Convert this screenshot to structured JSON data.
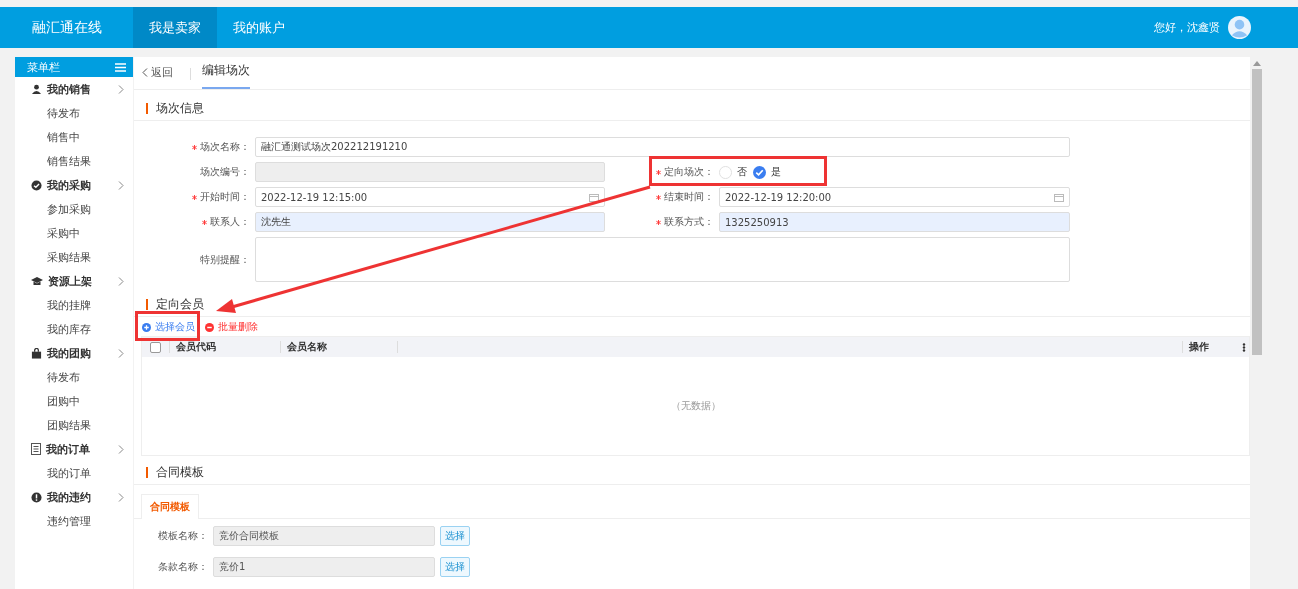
{
  "header": {
    "logo": "融汇通在线",
    "nav": [
      {
        "label": "我是卖家",
        "selected": true
      },
      {
        "label": "我的账户",
        "selected": false
      }
    ],
    "greeting": "您好，沈鑫贤"
  },
  "breadcrumb": {
    "back": "返回",
    "tab": "编辑场次"
  },
  "sidebar": {
    "title": "菜单栏",
    "groups": [
      {
        "label": "我的销售",
        "kind": "person",
        "children": [
          {
            "label": "待发布"
          },
          {
            "label": "销售中"
          },
          {
            "label": "销售结果"
          }
        ]
      },
      {
        "label": "我的采购",
        "kind": "check",
        "children": [
          {
            "label": "参加采购"
          },
          {
            "label": "采购中"
          },
          {
            "label": "采购结果"
          }
        ]
      },
      {
        "label": "资源上架",
        "kind": "cap",
        "children": [
          {
            "label": "我的挂牌"
          },
          {
            "label": "我的库存"
          }
        ]
      },
      {
        "label": "我的团购",
        "kind": "bag",
        "children": [
          {
            "label": "待发布"
          },
          {
            "label": "团购中"
          },
          {
            "label": "团购结果"
          }
        ]
      },
      {
        "label": "我的订单",
        "kind": "doc",
        "children": [
          {
            "label": "我的订单"
          }
        ]
      },
      {
        "label": "我的违约",
        "kind": "alert",
        "children": [
          {
            "label": "违约管理"
          }
        ]
      }
    ]
  },
  "info": {
    "title": "场次信息",
    "fields": [
      {
        "kind": "wide",
        "label": "场次名称：",
        "required": true,
        "value": "融汇通测试场次202212191210",
        "disabled": false,
        "autofilled": false
      },
      {
        "kind": "text",
        "label": "场次编号：",
        "required": false,
        "disabled": true,
        "autofilled": false
      },
      {
        "kind": "radio",
        "label": "定向场次：",
        "required": true,
        "options": [
          {
            "label": "否",
            "selected": false
          },
          {
            "label": "是",
            "selected": true
          }
        ]
      },
      {
        "kind": "date",
        "label": "开始时间：",
        "required": true,
        "value": "2022-12-19 12:15:00"
      },
      {
        "kind": "date",
        "label": "结束时间：",
        "required": true,
        "value": "2022-12-19 12:20:00"
      },
      {
        "kind": "text",
        "label": "联系人：",
        "required": true,
        "value": "沈先生",
        "disabled": false,
        "autofilled": true
      },
      {
        "kind": "text",
        "label": "联系方式：",
        "required": true,
        "value": "1325250913",
        "disabled": false,
        "autofilled": true
      },
      {
        "kind": "textarea",
        "label": "特别提醒：",
        "required": false
      }
    ]
  },
  "members": {
    "title": "定向会员",
    "actions": [
      {
        "label": "选择会员",
        "kind": "add"
      },
      {
        "label": "批量删除",
        "kind": "remove"
      }
    ],
    "select_all": false,
    "columns": [
      "会员代码",
      "会员名称",
      "操作"
    ],
    "empty_text": "（无数据）"
  },
  "contract": {
    "title": "合同模板",
    "tabs": [
      {
        "label": "合同模板",
        "selected": true
      }
    ],
    "fields": [
      {
        "label": "模板名称：",
        "value": "竞价合同模板",
        "button": "选择"
      },
      {
        "label": "条款名称：",
        "value": "竞价1",
        "button": "选择"
      }
    ]
  }
}
